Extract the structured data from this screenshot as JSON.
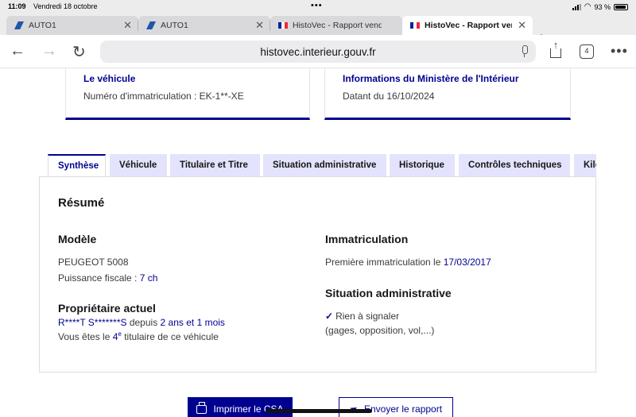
{
  "status_bar": {
    "time": "11:09",
    "date": "Vendredi 18 octobre",
    "more_dots": "•••",
    "battery_text": "93 %",
    "battery_level": 0.93
  },
  "browser_tabs": [
    {
      "label": "AUTO1",
      "favicon": "auto1-logo-icon",
      "active": false
    },
    {
      "label": "AUTO1",
      "favicon": "auto1-logo-icon",
      "active": false
    },
    {
      "label": "HistoVec - Rapport vendeur",
      "favicon": "french-flag-icon",
      "active": false
    },
    {
      "label": "HistoVec - Rapport vendeur",
      "favicon": "french-flag-icon",
      "active": true
    }
  ],
  "toolbar": {
    "url": "histovec.interieur.gouv.fr",
    "tab_count": "4"
  },
  "cards": {
    "vehicle": {
      "title": "Le véhicule",
      "label": "Numéro d'immatriculation : ",
      "value": "EK-1**-XE"
    },
    "ministry": {
      "title": "Informations du Ministère de l'Intérieur",
      "label": "Datant du ",
      "value": "16/10/2024"
    }
  },
  "tabs": [
    "Synthèse",
    "Véhicule",
    "Titulaire et Titre",
    "Situation administrative",
    "Historique",
    "Contrôles techniques",
    "Kilométrage"
  ],
  "summary": {
    "heading": "Résumé",
    "model": {
      "heading": "Modèle",
      "name": "PEUGEOT 5008",
      "power_label": "Puissance fiscale : ",
      "power_value": "7 ch"
    },
    "owner": {
      "heading": "Propriétaire actuel",
      "name": "R****T S*******S",
      "since_label": " depuis ",
      "since_value": "2 ans et 1 mois",
      "rank_prefix": "Vous êtes le ",
      "rank_num": "4",
      "rank_sup": "e",
      "rank_suffix": " titulaire de ce véhicule"
    },
    "registration": {
      "heading": "Immatriculation",
      "first_label": "Première immatriculation le ",
      "first_value": "17/03/2017"
    },
    "admin": {
      "heading": "Situation administrative",
      "status": "Rien à signaler",
      "details": "(gages, opposition, vol,...)"
    }
  },
  "actions": {
    "print_label": "Imprimer le CSA",
    "send_label": "Envoyer le rapport"
  },
  "colors": {
    "accent": "#000091",
    "tab_bg": "#e3e3fd"
  }
}
